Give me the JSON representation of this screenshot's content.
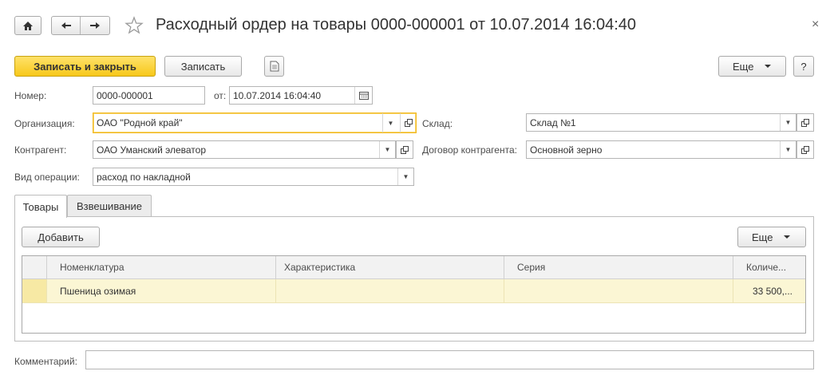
{
  "window": {
    "title": "Расходный ордер на товары 0000-000001 от 10.07.2014 16:04:40",
    "close_glyph": "×"
  },
  "nav": {
    "home_icon": "home-icon",
    "back_icon": "arrow-left-icon",
    "forward_icon": "arrow-right-icon",
    "favorite_icon": "star-icon"
  },
  "toolbar": {
    "save_close_label": "Записать и закрыть",
    "save_label": "Записать",
    "doc_icon": "document-icon",
    "more_label": "Еще",
    "help_label": "?"
  },
  "form": {
    "number_label": "Номер:",
    "number_value": "0000-000001",
    "date_label": "от:",
    "date_value": "10.07.2014 16:04:40",
    "org_label": "Организация:",
    "org_value": "ОАО \"Родной край\"",
    "warehouse_label": "Склад:",
    "warehouse_value": "Склад №1",
    "contractor_label": "Контрагент:",
    "contractor_value": "ОАО Уманский элеватор",
    "contract_label": "Договор контрагента:",
    "contract_value": "Основной зерно",
    "operation_label": "Вид операции:",
    "operation_value": "расход по накладной",
    "comment_label": "Комментарий:",
    "comment_value": ""
  },
  "tabs": [
    {
      "label": "Товары",
      "active": true
    },
    {
      "label": "Взвешивание",
      "active": false
    }
  ],
  "table": {
    "add_label": "Добавить",
    "more_label": "Еще",
    "columns": [
      "Номенклатура",
      "Характеристика",
      "Серия",
      "Количе..."
    ],
    "rows": [
      {
        "nomenclature": "Пшеница озимая",
        "characteristic": "",
        "series": "",
        "quantity": "33 500,..."
      }
    ]
  },
  "colors": {
    "accent": "#f7c81a",
    "focus_border": "#f2b81e",
    "selected_row": "#fbf6d4"
  }
}
